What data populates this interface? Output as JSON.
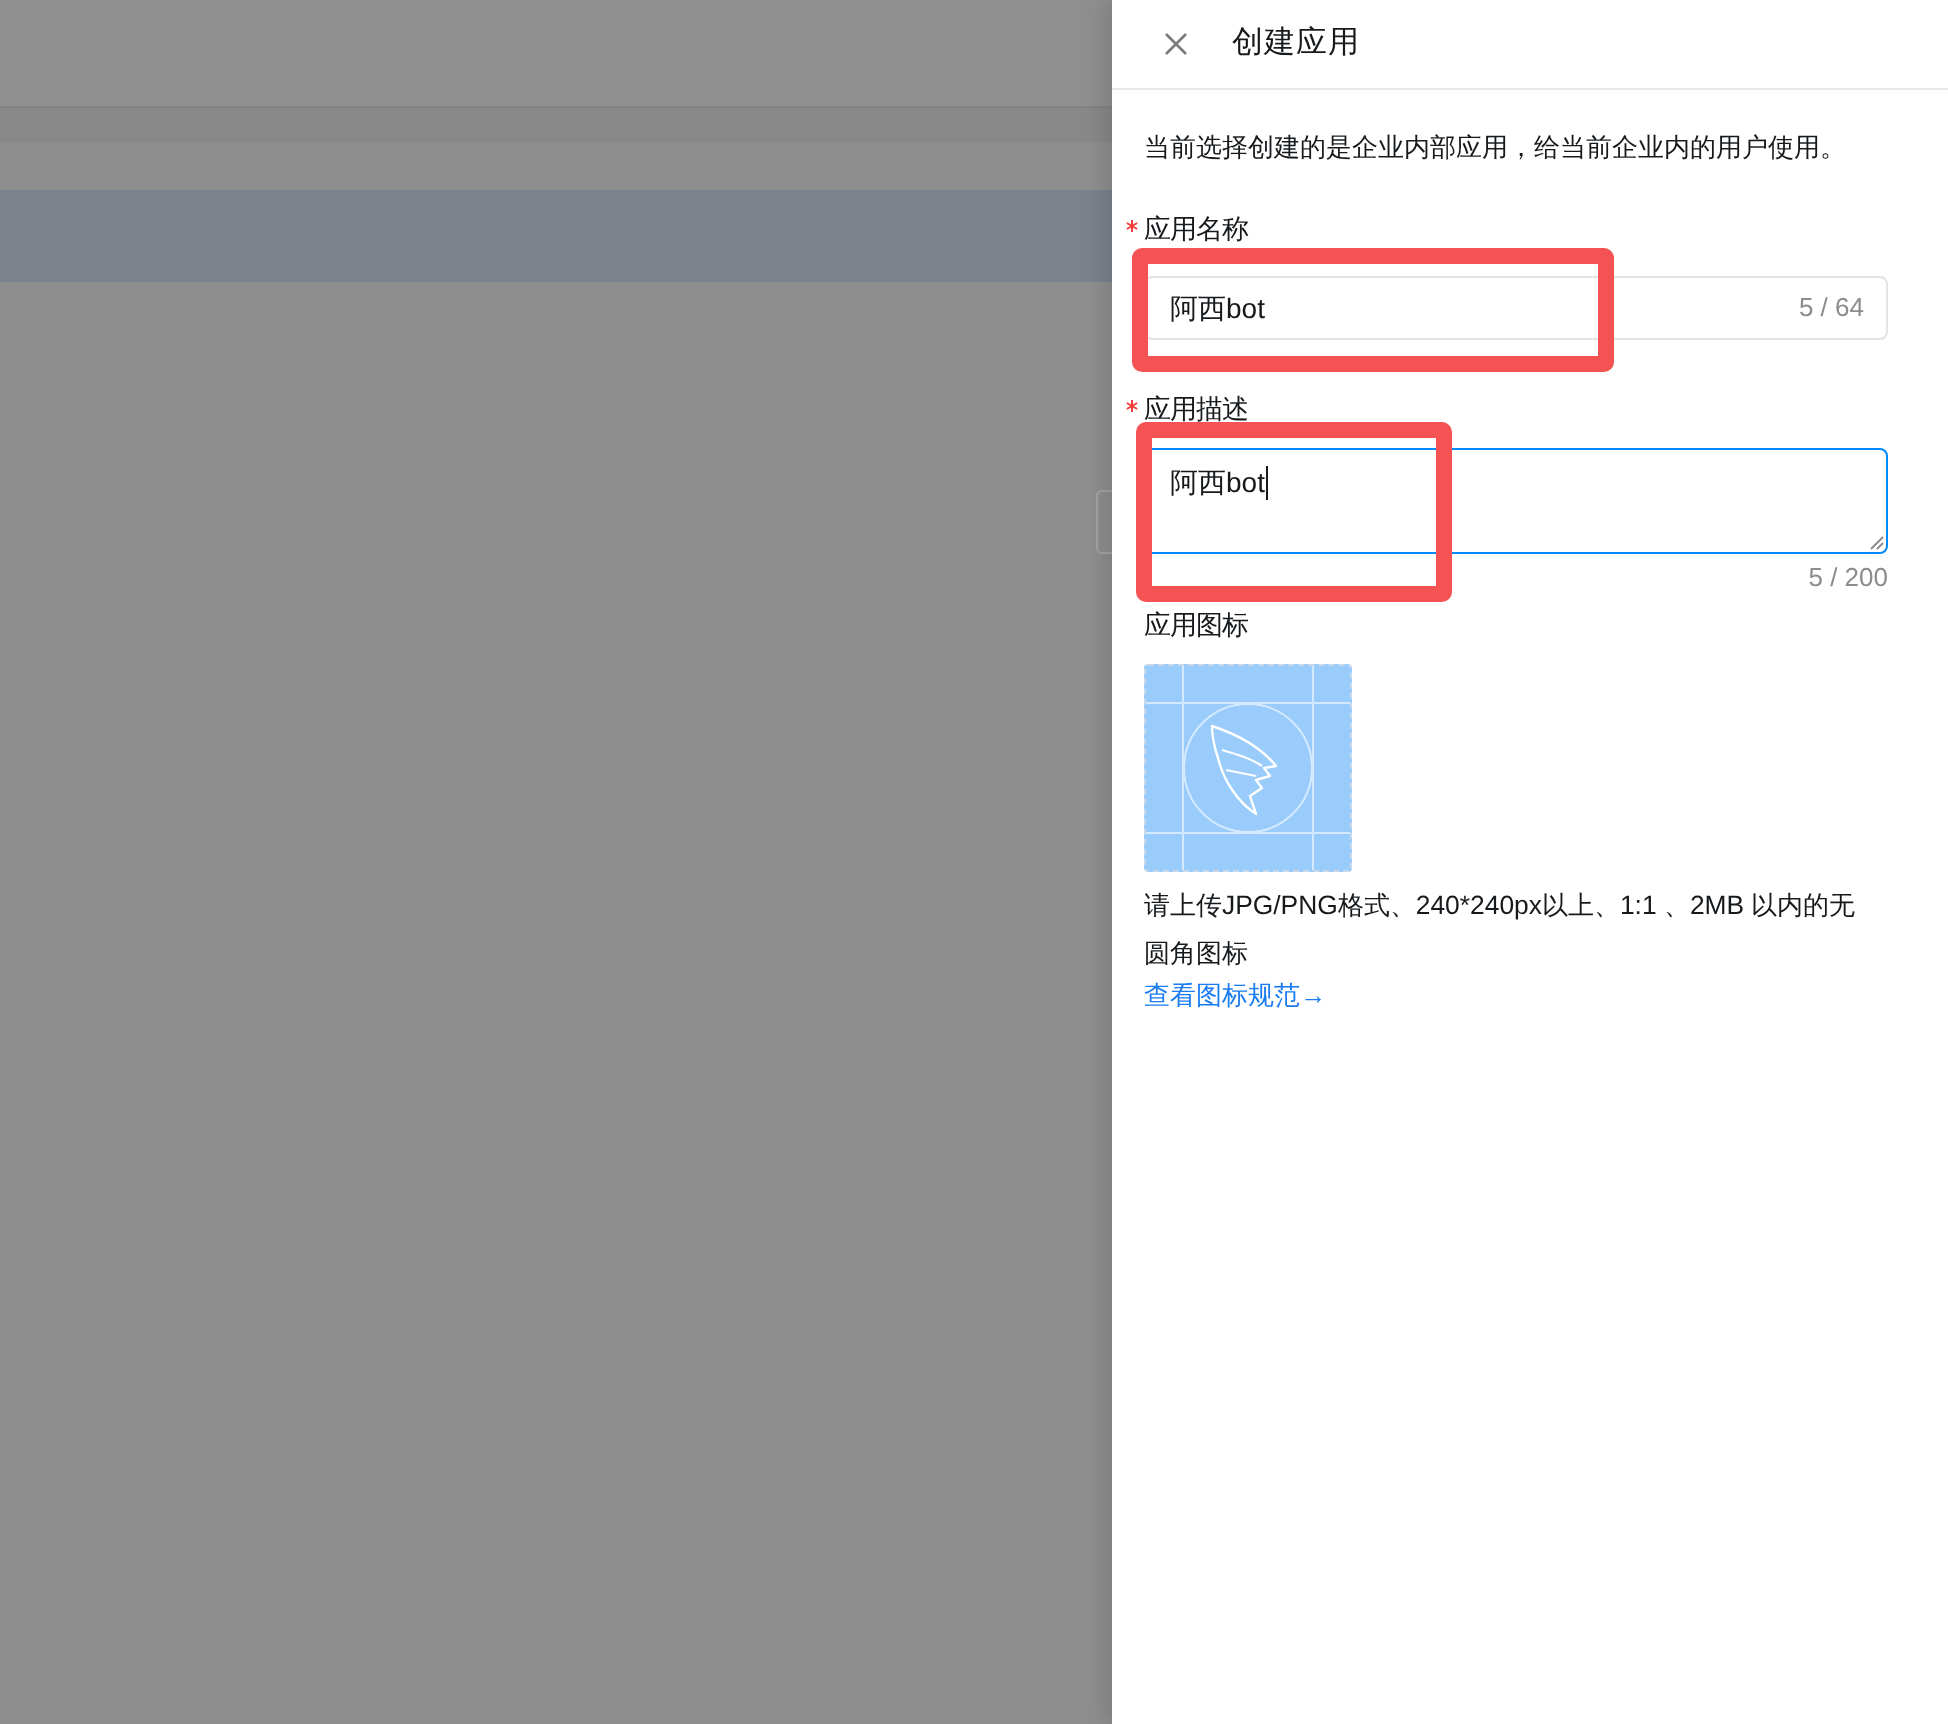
{
  "drawer": {
    "title": "创建应用",
    "intro": "当前选择创建的是企业内部应用，给当前企业内的用户使用。"
  },
  "fields": [
    {
      "kind": "input",
      "label": "应用名称",
      "required": true,
      "value": "阿西bot",
      "counter": "5 / 64",
      "focused": false
    },
    {
      "kind": "textarea",
      "label": "应用描述",
      "required": true,
      "value": "阿西bot",
      "counter": "5 / 200",
      "focused": true
    }
  ],
  "icon_upload": {
    "label": "应用图标",
    "hint": "请上传JPG/PNG格式、240*240px以上、1:1 、2MB 以内的无圆角图标",
    "link": "查看图标规范→"
  }
}
